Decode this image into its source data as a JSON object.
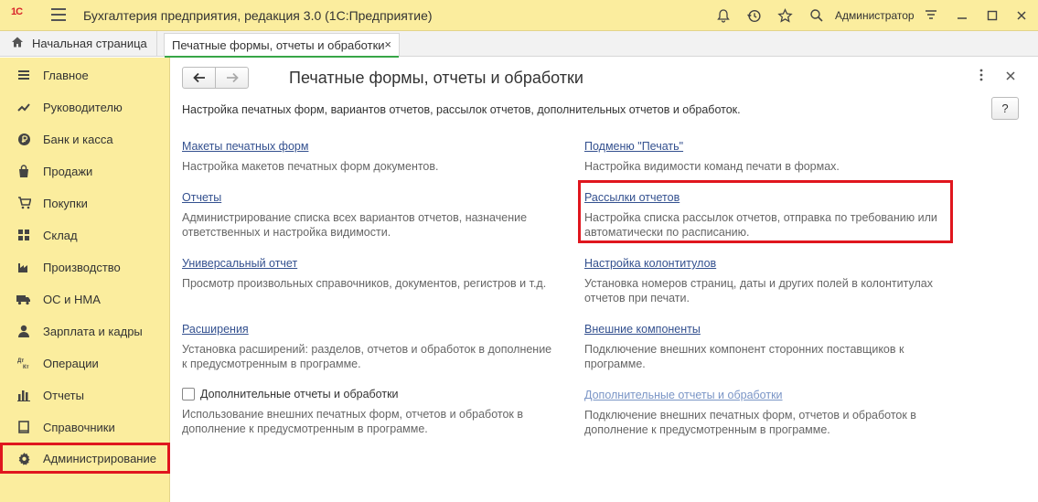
{
  "titlebar": {
    "logo": "1С",
    "app_title": "Бухгалтерия предприятия, редакция 3.0  (1С:Предприятие)",
    "user": "Администратор"
  },
  "tabs": {
    "home": "Начальная страница",
    "active": "Печатные формы, отчеты и обработки",
    "close": "×"
  },
  "sidebar": {
    "items": [
      {
        "label": "Главное",
        "icon": "menu-icon"
      },
      {
        "label": "Руководителю",
        "icon": "trend-icon"
      },
      {
        "label": "Банк и касса",
        "icon": "ruble-icon"
      },
      {
        "label": "Продажи",
        "icon": "bag-icon"
      },
      {
        "label": "Покупки",
        "icon": "cart-icon"
      },
      {
        "label": "Склад",
        "icon": "warehouse-icon"
      },
      {
        "label": "Производство",
        "icon": "factory-icon"
      },
      {
        "label": "ОС и НМА",
        "icon": "truck-icon"
      },
      {
        "label": "Зарплата и кадры",
        "icon": "person-icon"
      },
      {
        "label": "Операции",
        "icon": "dt-kt-icon"
      },
      {
        "label": "Отчеты",
        "icon": "bar-chart-icon"
      },
      {
        "label": "Справочники",
        "icon": "book-icon"
      },
      {
        "label": "Администрирование",
        "icon": "gear-icon"
      }
    ]
  },
  "form": {
    "title": "Печатные формы, отчеты и обработки",
    "description": "Настройка печатных форм, вариантов отчетов, рассылок отчетов, дополнительных отчетов и обработок.",
    "help": "?",
    "left": [
      {
        "link": "Макеты печатных форм",
        "text": "Настройка макетов печатных форм документов."
      },
      {
        "link": "Отчеты",
        "text": "Администрирование списка всех вариантов отчетов, назначение ответственных и настройка видимости."
      },
      {
        "link": "Универсальный отчет",
        "text": "Просмотр произвольных справочников, документов, регистров и т.д."
      },
      {
        "link": "Расширения",
        "text": "Установка расширений: разделов, отчетов и обработок в дополнение к предусмотренным в программе."
      },
      {
        "checkbox": "Дополнительные отчеты и обработки",
        "text": "Использование внешних печатных форм, отчетов и обработок в дополнение к предусмотренным в программе."
      }
    ],
    "right": [
      {
        "link": "Подменю \"Печать\"",
        "text": "Настройка видимости команд печати в формах."
      },
      {
        "link": "Рассылки отчетов",
        "text": "Настройка списка рассылок отчетов, отправка по требованию или автоматически по расписанию."
      },
      {
        "link": "Настройка колонтитулов",
        "text": "Установка номеров страниц, даты и других полей в колонтитулах отчетов при печати."
      },
      {
        "link": "Внешние компоненты",
        "text": "Подключение внешних компонент сторонних поставщиков к программе."
      },
      {
        "link": "Дополнительные отчеты и обработки",
        "text": "Подключение внешних печатных форм, отчетов и обработок в дополнение к предусмотренным в программе."
      }
    ]
  }
}
